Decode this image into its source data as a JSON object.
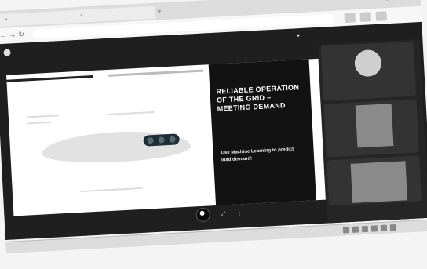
{
  "browser": {
    "tabs": [
      {
        "title": "",
        "close": "×"
      },
      {
        "title": "",
        "close": "×"
      }
    ],
    "new_tab": "+",
    "window": {
      "min": "–",
      "max": "□",
      "close": "×"
    },
    "nav": {
      "back": "←",
      "forward": "→",
      "reload": "↻"
    },
    "url": ""
  },
  "meet": {
    "title": "",
    "rec_icon": "●",
    "rec_text": "",
    "slide": {
      "title": "RELIABLE OPERATION OF THE GRID – MEETING DEMAND",
      "subtitle": "Use Machine Learning to predict load demand!"
    },
    "participants": [
      {
        "name": ""
      },
      {
        "name": ""
      },
      {
        "name": ""
      }
    ],
    "controls": {
      "end": "",
      "cc": "⤢",
      "more": "⋮"
    },
    "footer": ""
  },
  "taskbar": {
    "clock_time": "",
    "clock_date": ""
  },
  "colors": {
    "meet_bg": "#1f1f1f",
    "slide_bg": "#121212",
    "stage_bg": "#ffffff"
  }
}
